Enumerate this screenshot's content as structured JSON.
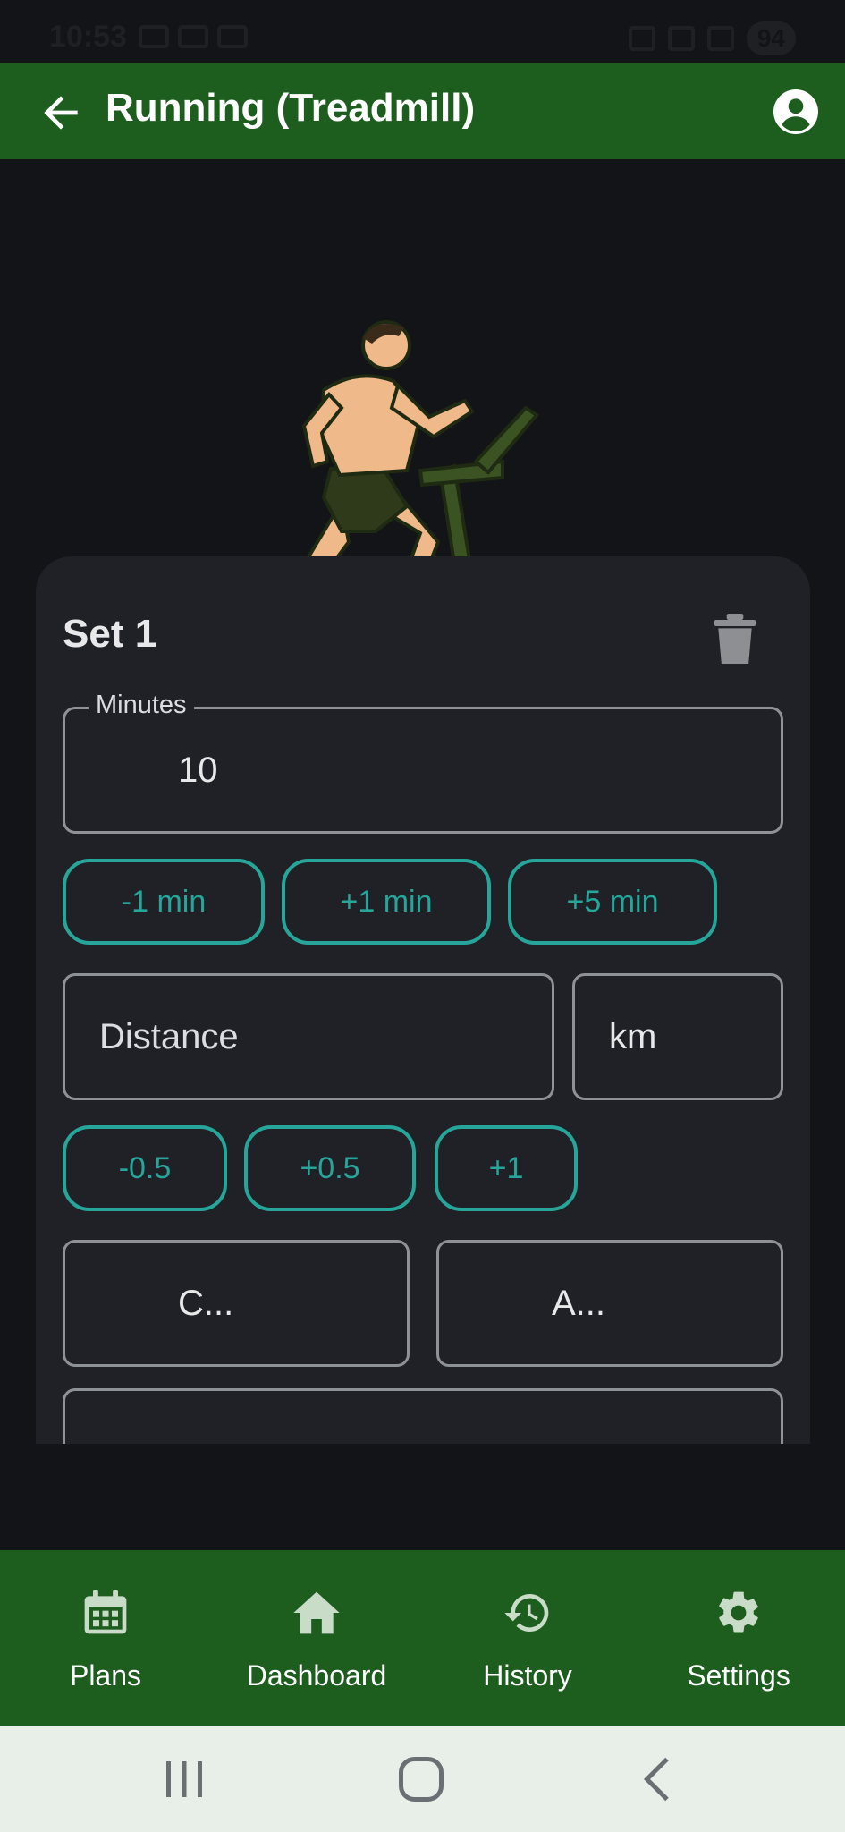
{
  "status_bar": {
    "time": "10:53",
    "battery": "94"
  },
  "app_bar": {
    "title": "Running (Treadmill)"
  },
  "set": {
    "title": "Set 1",
    "minutes": {
      "label": "Minutes",
      "value": "10"
    },
    "minute_chips": [
      "-1 min",
      "+1 min",
      "+5 min"
    ],
    "distance": {
      "placeholder": "Distance",
      "unit": "km"
    },
    "distance_chips": [
      "-0.5",
      "+0.5",
      "+1"
    ],
    "field_c": "C...",
    "field_a": "A..."
  },
  "bottom_nav": {
    "items": [
      {
        "label": "Plans",
        "icon": "calendar-icon"
      },
      {
        "label": "Dashboard",
        "icon": "home-icon"
      },
      {
        "label": "History",
        "icon": "history-icon"
      },
      {
        "label": "Settings",
        "icon": "gear-icon"
      }
    ]
  },
  "colors": {
    "app_bar": "#1d5e1f",
    "accent": "#26a69a",
    "card": "#202126",
    "background": "#121418"
  }
}
